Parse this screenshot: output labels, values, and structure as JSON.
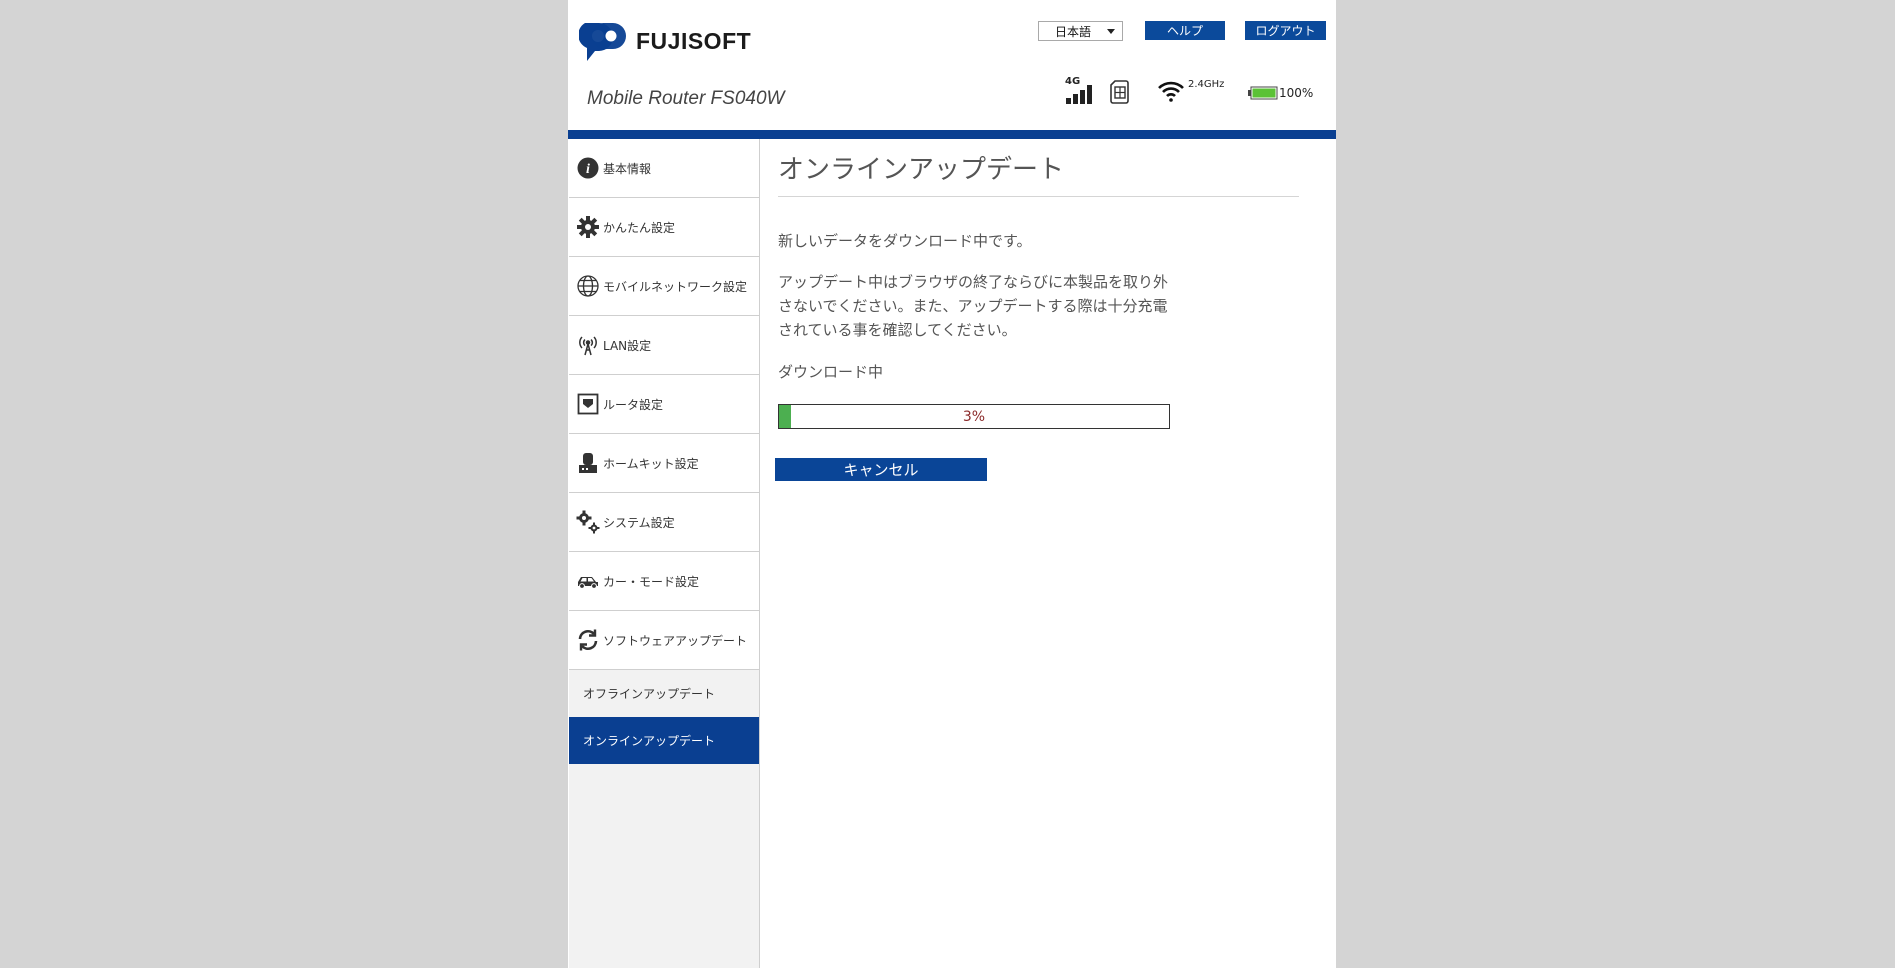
{
  "header": {
    "brand": "FUJISOFT",
    "model": "Mobile Router FS040W",
    "language": {
      "selected": "日本語"
    },
    "help_label": "ヘルプ",
    "logout_label": "ログアウト",
    "status": {
      "network_type": "4G",
      "signal_level": 4,
      "wifi_band": "2.4GHz",
      "battery": "100%",
      "battery_level": 1.0
    }
  },
  "sidebar": {
    "items": [
      {
        "label": "基本情報",
        "icon": "info-icon"
      },
      {
        "label": "かんたん設定",
        "icon": "gear-icon"
      },
      {
        "label": "モバイルネットワーク設定",
        "icon": "globe-icon"
      },
      {
        "label": "LAN設定",
        "icon": "antenna-icon"
      },
      {
        "label": "ルータ設定",
        "icon": "router-icon"
      },
      {
        "label": "ホームキット設定",
        "icon": "homekit-icon"
      },
      {
        "label": "システム設定",
        "icon": "gears-icon"
      },
      {
        "label": "カー・モード設定",
        "icon": "car-icon"
      },
      {
        "label": "ソフトウェアアップデート",
        "icon": "refresh-icon"
      }
    ],
    "sub_items": [
      {
        "label": "オフラインアップデート",
        "active": false
      },
      {
        "label": "オンラインアップデート",
        "active": true
      }
    ]
  },
  "main": {
    "title": "オンラインアップデート",
    "message1": "新しいデータをダウンロード中です。",
    "message2": "アップデート中はブラウザの終了ならびに本製品を取り外さないでください。また、アップデートする際は十分充電されている事を確認してください。",
    "status": "ダウンロード中",
    "progress_text": "3%",
    "progress_value": 0.03,
    "cancel_label": "キャンセル"
  },
  "colors": {
    "accent": "#0a3f91",
    "progress_fill": "#4caf50",
    "progress_text": "#8b2a2a"
  }
}
